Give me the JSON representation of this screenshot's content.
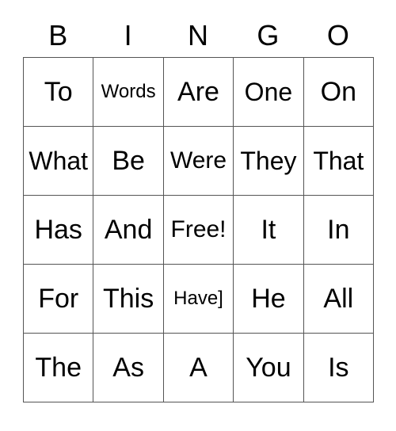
{
  "card": {
    "headers": [
      "B",
      "I",
      "N",
      "G",
      "O"
    ],
    "rows": [
      [
        {
          "text": "To",
          "size": "xl"
        },
        {
          "text": "Words",
          "size": "sm"
        },
        {
          "text": "Are",
          "size": "xl"
        },
        {
          "text": "One",
          "size": "lg"
        },
        {
          "text": "On",
          "size": "xl"
        }
      ],
      [
        {
          "text": "What",
          "size": "lg"
        },
        {
          "text": "Be",
          "size": "xl"
        },
        {
          "text": "Were",
          "size": "md"
        },
        {
          "text": "They",
          "size": "lg"
        },
        {
          "text": "That",
          "size": "lg"
        }
      ],
      [
        {
          "text": "Has",
          "size": "xl"
        },
        {
          "text": "And",
          "size": "xl"
        },
        {
          "text": "Free!",
          "size": "md"
        },
        {
          "text": "It",
          "size": "xl"
        },
        {
          "text": "In",
          "size": "xl"
        }
      ],
      [
        {
          "text": "For",
          "size": "xl"
        },
        {
          "text": "This",
          "size": "xl"
        },
        {
          "text": "Have]",
          "size": "sm"
        },
        {
          "text": "He",
          "size": "xl"
        },
        {
          "text": "All",
          "size": "xl"
        }
      ],
      [
        {
          "text": "The",
          "size": "xl"
        },
        {
          "text": "As",
          "size": "xl"
        },
        {
          "text": "A",
          "size": "xl"
        },
        {
          "text": "You",
          "size": "xl"
        },
        {
          "text": "Is",
          "size": "xl"
        }
      ]
    ],
    "free_space": {
      "row": 2,
      "col": 2,
      "label": "Free!"
    },
    "colors": {
      "background": "#ffffff",
      "text": "#000000",
      "gridline": "#555555"
    }
  }
}
